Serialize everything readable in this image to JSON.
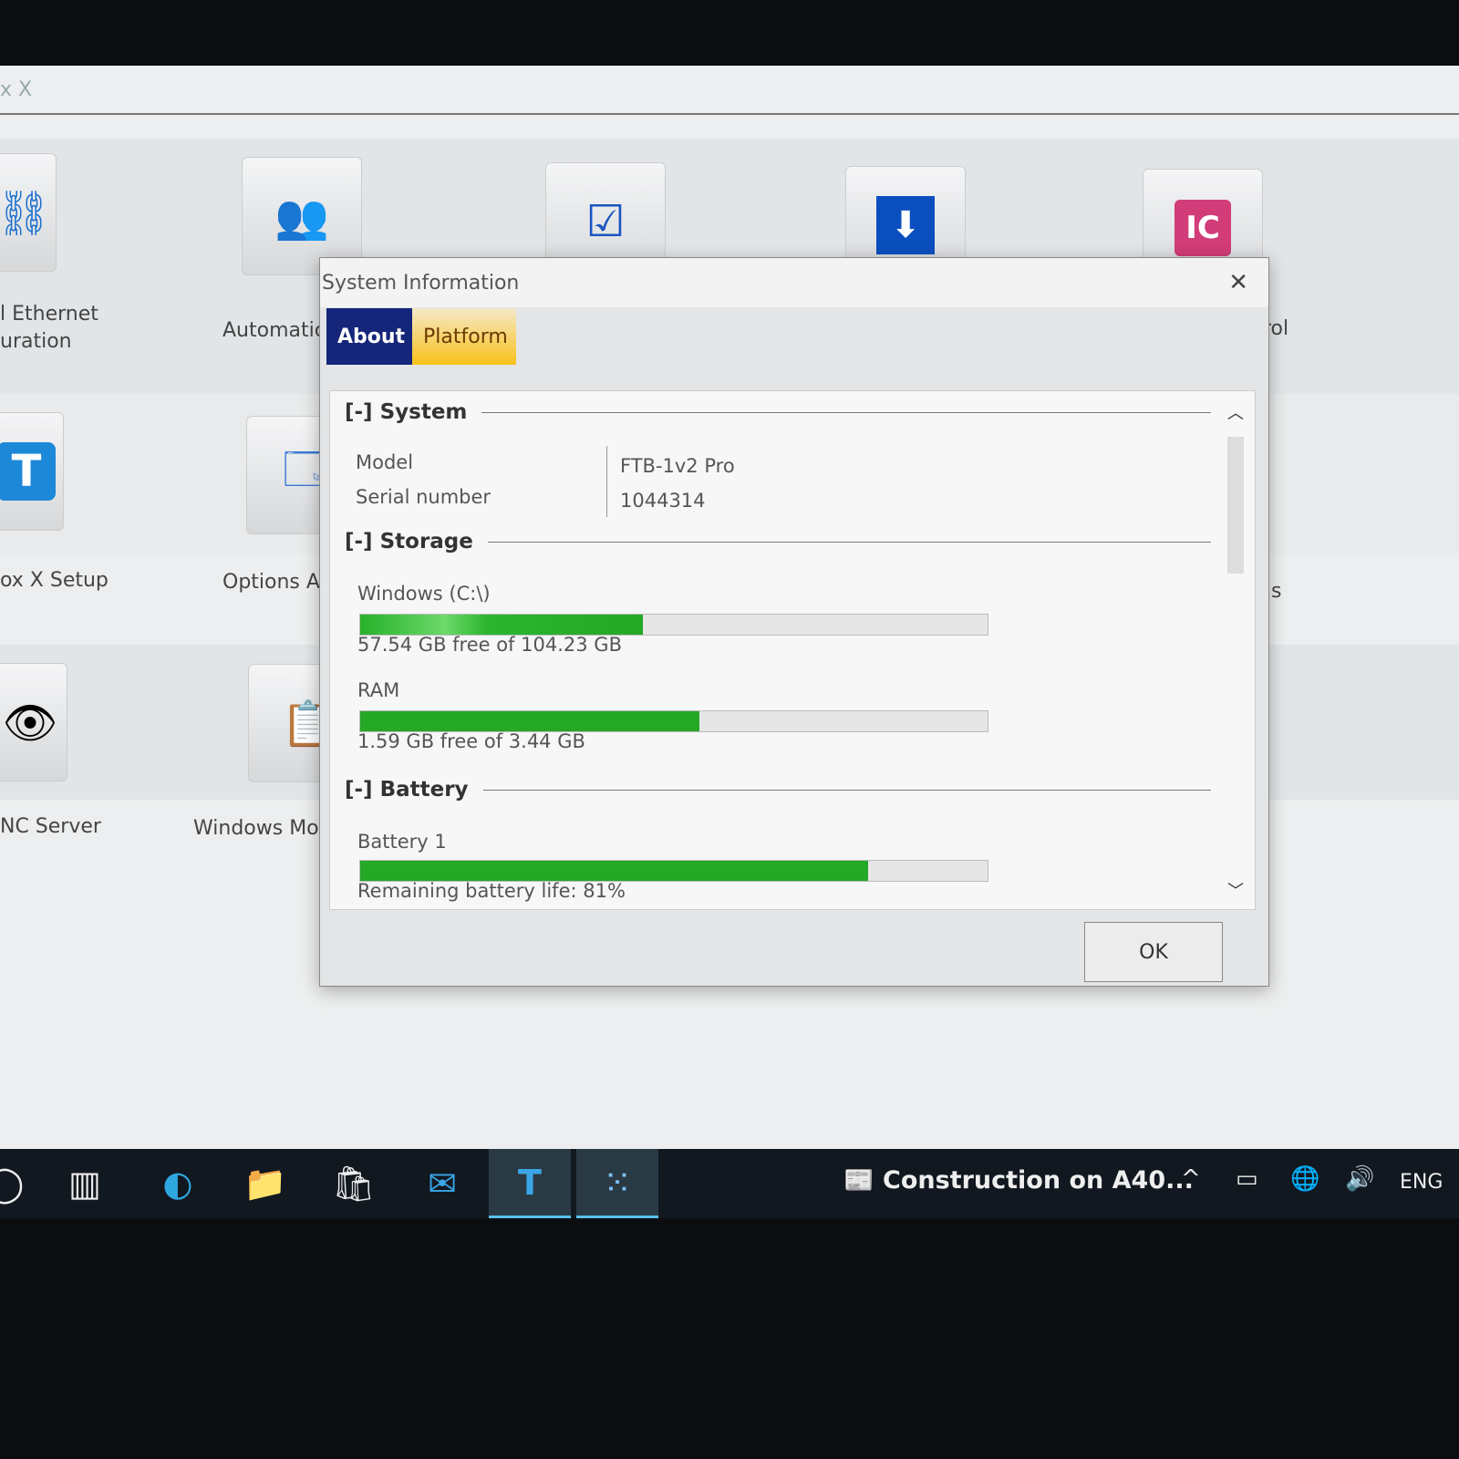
{
  "app": {
    "title": "x X",
    "tiles": [
      {
        "icon": "network-icon",
        "label": "l Ethernet\nuration"
      },
      {
        "icon": "users-key-icon",
        "label": "Automatic"
      },
      {
        "icon": "checklist-pen-icon",
        "label": ""
      },
      {
        "icon": "download-icon",
        "label": ""
      },
      {
        "icon": "ic-gear-icon",
        "label": "rol"
      },
      {
        "icon": "t-app-icon",
        "label": "ox X Setup"
      },
      {
        "icon": "window-options-icon",
        "label": "Options A"
      },
      {
        "label": "ns"
      },
      {
        "icon": "eye-icon",
        "label": "NC Server"
      },
      {
        "icon": "mobile-sync-icon",
        "label": "Windows Mob"
      }
    ]
  },
  "dialog": {
    "title": "System Information",
    "tabs": [
      {
        "label": "About",
        "active": true
      },
      {
        "label": "Platform",
        "active": false
      }
    ],
    "system": {
      "header": "[-] System",
      "model_label": "Model",
      "model": "FTB-1v2 Pro",
      "serial_label": "Serial number",
      "serial": "1044314"
    },
    "storage": {
      "header": "[-] Storage",
      "drives": [
        {
          "label": "Windows (C:\\)",
          "used_percent": 45,
          "text": "57.54 GB free of 104.23 GB"
        },
        {
          "label": "RAM",
          "used_percent": 54,
          "text": "1.59 GB free of 3.44 GB"
        }
      ]
    },
    "battery": {
      "header": "[-] Battery",
      "label": "Battery 1",
      "percent": 81,
      "text": "Remaining battery life: 81%"
    },
    "ok_label": "OK",
    "accent": "#15267a",
    "tab2_color": "#f7c21a",
    "bar_color": "#27b12a"
  },
  "taskbar": {
    "news": "Construction on A40...",
    "lang": "ENG"
  }
}
